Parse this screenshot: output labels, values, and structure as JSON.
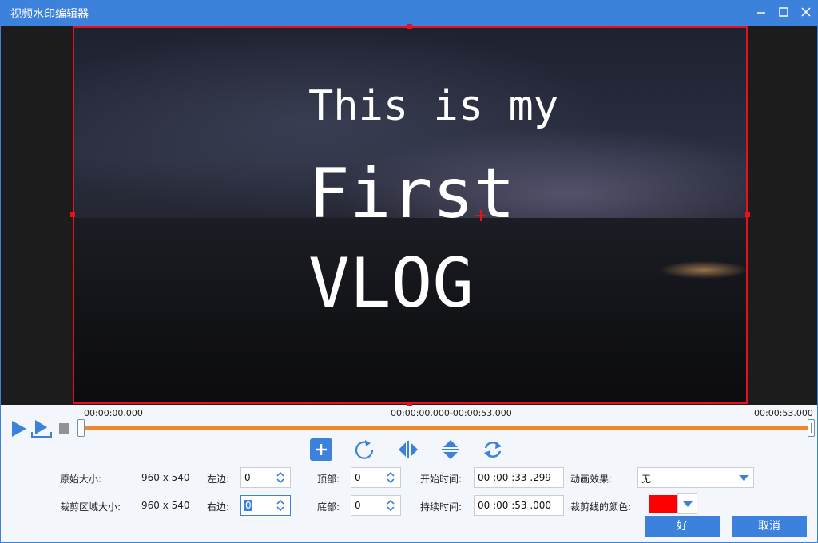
{
  "window": {
    "title": "视频水印编辑器"
  },
  "colors": {
    "accent": "#3c82dd",
    "crop_line": "#e8101a",
    "timeline": "#f0892d",
    "crop_line_color_value": "#ff0000"
  },
  "video": {
    "overlay_lines": [
      "This is my",
      "First",
      "VLOG"
    ]
  },
  "timeline": {
    "start": "00:00:00.000",
    "range": "00:00:00.000-00:00:53.000",
    "end": "00:00:53.000"
  },
  "toolbar": {
    "icons": [
      "add-icon",
      "rotate-icon",
      "flip-horizontal-icon",
      "flip-vertical-icon",
      "reset-icon"
    ]
  },
  "form": {
    "original_size_label": "原始大小:",
    "original_size_value": "960 x 540",
    "crop_size_label": "裁剪区域大小:",
    "crop_size_value": "960 x 540",
    "left_label": "左边:",
    "left_value": "0",
    "right_label": "右边:",
    "right_value": "0",
    "top_label": "顶部:",
    "top_value": "0",
    "bottom_label": "底部:",
    "bottom_value": "0",
    "start_time_label": "开始时间:",
    "start_time_value": "00 :00 :33 .299",
    "duration_label": "持续时间:",
    "duration_value": "00 :00 :53 .000",
    "animation_label": "动画效果:",
    "animation_value": "无",
    "crop_line_color_label": "裁剪线的颜色:"
  },
  "buttons": {
    "ok": "好",
    "cancel": "取消"
  }
}
